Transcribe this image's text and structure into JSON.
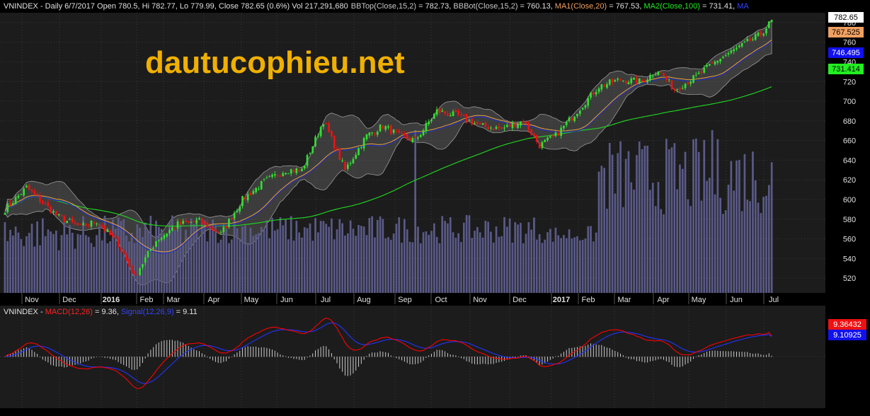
{
  "colors": {
    "background": "#000000",
    "panel_bg": "#1c1c1c",
    "grid": "#3a3a3a",
    "candle_up": "#33dd33",
    "candle_down": "#ee1111",
    "volume": "#5a5a88",
    "bb_fill": "#777777",
    "ma1": "#e8a040",
    "ma2": "#22cc22",
    "bb_mid": "#2030d0",
    "macd": "#ff0000",
    "signal": "#2233ff",
    "histogram": "#cccccc",
    "watermark": "#f0b000"
  },
  "main_header": {
    "title": "VNINDEX - Daily 6/7/2017 Open 780.5, Hi 782.77, Lo 779.99, Close 782.65 (0.6%) Vol 217,291,680",
    "bbtop_label": "BBTop(Close,15,2)",
    "bbtop_value": " = 782.73, ",
    "bbbot_label": "BBBot(Close,15,2)",
    "bbbot_value": " = 760.13, ",
    "ma1_label": "MA1(Close,20)",
    "ma1_value": " = 767.53, ",
    "ma2_label": "MA2(Close,100)",
    "ma2_value": " = 731.41, ",
    "overflow_label": "MA"
  },
  "watermark": "dautucophieu.net",
  "price_badges": [
    {
      "text": "782.65",
      "value": 782.65,
      "bg": "#ffffff",
      "fg": "#000000"
    },
    {
      "text": "767.525",
      "value": 767.525,
      "bg": "#f0a060",
      "fg": "#000000"
    },
    {
      "text": "746.495",
      "value": 746.495,
      "bg": "#1111ee",
      "fg": "#ffffff"
    },
    {
      "text": "731.414",
      "value": 731.414,
      "bg": "#22ee22",
      "fg": "#000000"
    }
  ],
  "macd_header": {
    "prefix": "VNINDEX - ",
    "macd_label": "MACD(12,26)",
    "macd_value": " = 9.36, ",
    "signal_label": "Signal(12,26,9)",
    "signal_value": " = 9.11"
  },
  "macd_badges": [
    {
      "text": "9.36432",
      "value": 9.36,
      "bg": "#ee1111",
      "fg": "#ffffff"
    },
    {
      "text": "9.10925",
      "value": 9.11,
      "bg": "#1111ee",
      "fg": "#ffffff"
    }
  ],
  "chart_data": [
    {
      "type": "candlestick",
      "title": "VNINDEX - Daily 6/7/2017",
      "xlabel": "",
      "ylabel": "",
      "ylim": [
        505,
        790
      ],
      "y_ticks": [
        520,
        540,
        560,
        580,
        600,
        620,
        640,
        660,
        680,
        700,
        720,
        740,
        760,
        780
      ],
      "grid": true,
      "x_tick_labels": [
        "Nov",
        "Dec",
        "2016",
        "Feb",
        "Mar",
        "Apr",
        "May",
        "Jun",
        "Jul",
        "Aug",
        "Sep",
        "Oct",
        "Nov",
        "Dec",
        "2017",
        "Feb",
        "Mar",
        "Apr",
        "May",
        "Jun",
        "Jul"
      ],
      "x_tick_bold": [
        false,
        false,
        true,
        false,
        false,
        false,
        false,
        false,
        false,
        false,
        false,
        false,
        false,
        false,
        true,
        false,
        false,
        false,
        false,
        false,
        false
      ],
      "close_keyframes": [
        [
          0,
          590
        ],
        [
          8,
          612
        ],
        [
          20,
          582
        ],
        [
          28,
          572
        ],
        [
          34,
          578
        ],
        [
          42,
          555
        ],
        [
          48,
          522
        ],
        [
          56,
          558
        ],
        [
          64,
          575
        ],
        [
          72,
          578
        ],
        [
          80,
          565
        ],
        [
          88,
          600
        ],
        [
          96,
          618
        ],
        [
          104,
          630
        ],
        [
          110,
          630
        ],
        [
          118,
          680
        ],
        [
          126,
          630
        ],
        [
          134,
          665
        ],
        [
          140,
          675
        ],
        [
          146,
          665
        ],
        [
          152,
          660
        ],
        [
          160,
          690
        ],
        [
          168,
          685
        ],
        [
          176,
          675
        ],
        [
          184,
          672
        ],
        [
          192,
          680
        ],
        [
          198,
          655
        ],
        [
          204,
          665
        ],
        [
          212,
          690
        ],
        [
          220,
          715
        ],
        [
          228,
          722
        ],
        [
          236,
          720
        ],
        [
          242,
          732
        ],
        [
          248,
          712
        ],
        [
          256,
          725
        ],
        [
          264,
          742
        ],
        [
          272,
          755
        ],
        [
          280,
          768
        ],
        [
          284,
          782
        ]
      ],
      "last_bar": {
        "date": "6/7/2017",
        "open": 780.5,
        "high": 782.77,
        "low": 779.99,
        "close": 782.65
      },
      "series": [
        {
          "name": "MA1(Close,20)",
          "last": 767.53
        },
        {
          "name": "MA2(Close,100)",
          "last": 731.41
        },
        {
          "name": "BBTop(Close,15,2)",
          "last": 782.73
        },
        {
          "name": "BBBot(Close,15,2)",
          "last": 760.13
        }
      ],
      "volume_last": 217291680
    },
    {
      "type": "line",
      "title": "MACD(12,26)",
      "series": [
        {
          "name": "MACD(12,26)",
          "last": 9.36
        },
        {
          "name": "Signal(12,26,9)",
          "last": 9.11
        }
      ]
    }
  ]
}
